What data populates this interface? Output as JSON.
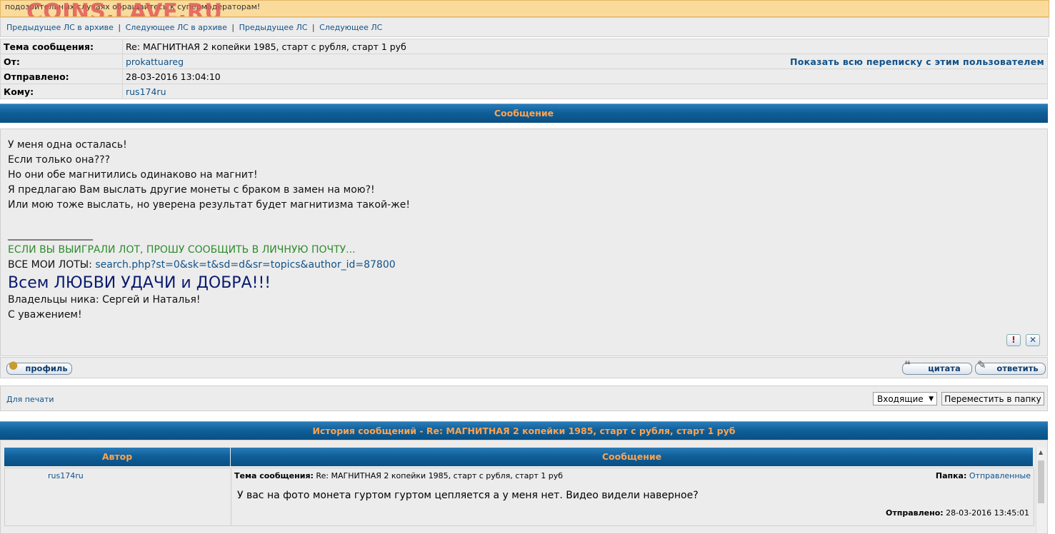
{
  "banner": {
    "text": "подозрительных случаях обращайтесь к супермодераторам!",
    "watermark": "COINS.LAVE.RU"
  },
  "nav": {
    "prev_archive": "Предыдущее ЛС в архиве",
    "next_archive": "Следующее ЛС в архиве",
    "prev": "Предыдущее ЛС",
    "next": "Следующее ЛС",
    "separator": "|"
  },
  "header": {
    "subject_label": "Тема сообщения:",
    "subject": "Re: МАГНИТНАЯ 2 копейки 1985, старт с рубля, старт 1 руб",
    "from_label": "От:",
    "from": "prokattuareg",
    "show_all": "Показать всю переписку с этим пользователем",
    "sent_label": "Отправлено:",
    "sent": "28-03-2016 13:04:10",
    "to_label": "Кому:",
    "to": "rus174ru"
  },
  "message": {
    "title": "Сообщение",
    "lines": [
      "У меня одна осталась!",
      "Если только она???",
      "Но они обе магнитились одинаково на магнит!",
      "Я предлагаю Вам выслать другие монеты с браком в замен на мою?!",
      "Или мою тоже выслать, но уверена результат будет магнитизма такой-же!"
    ],
    "signature_rule": "_________________",
    "sig_green": "ЕСЛИ ВЫ ВЫИГРАЛИ ЛОТ, ПРОШУ СООБЩИТЬ В ЛИЧНУЮ ПОЧТУ...",
    "sig_lots_label": "ВСЕ МОИ ЛОТЫ: ",
    "sig_lots_link": "search.php?st=0&sk=t&sd=d&sr=topics&author_id=87800",
    "sig_big": "Всем ЛЮБВИ УДАЧИ и ДОБРА!!!",
    "sig_owners": "Владельцы ника: Сергей и Наталья!",
    "sig_regards": "С уважением!"
  },
  "buttons": {
    "report_icon": "exclamation-icon",
    "delete_icon": "close-icon",
    "profile": "профиль",
    "quote": "цитата",
    "reply": "ответить"
  },
  "tools": {
    "print": "Для печати",
    "folder_selected": "Входящие",
    "move": "Переместить в папку"
  },
  "history": {
    "title": "История сообщений - Re: МАГНИТНАЯ 2 копейки 1985, старт с рубля, старт 1 руб",
    "col_author": "Автор",
    "col_message": "Сообщение",
    "author": "rus174ru",
    "subject_label": "Тема сообщения:",
    "subject": "Re: МАГНИТНАЯ 2 копейки 1985, старт с рубля, старт 1 руб",
    "folder_label": "Папка:",
    "folder": "Отправленные",
    "text": "У вас на фото монета гуртом гуртом цепляется а у меня нет. Видео видели наверное?",
    "sent_label": "Отправлено:",
    "sent": "28-03-2016 13:45:01"
  }
}
